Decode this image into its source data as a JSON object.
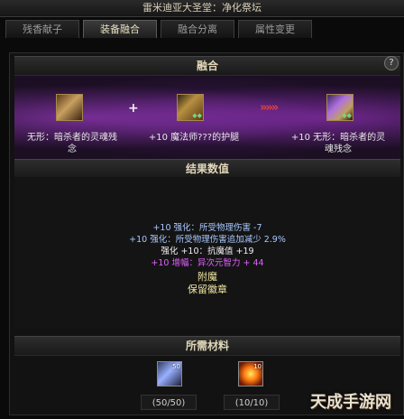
{
  "window": {
    "title": "雷米迪亚大圣堂：净化祭坛"
  },
  "tabs": [
    {
      "label": "残香献子",
      "active": false
    },
    {
      "label": "装备融合",
      "active": true
    },
    {
      "label": "融合分离",
      "active": false
    },
    {
      "label": "属性变更",
      "active": false
    }
  ],
  "fusion": {
    "title": "融合",
    "help_label": "?",
    "items": [
      {
        "icon": "gauntlet-item-icon",
        "label": "无形：暗杀者的灵魂残念"
      },
      {
        "icon": "leg-armor-item-icon",
        "label": "+10 魔法师???的护腿"
      },
      {
        "icon": "fused-leg-armor-item-icon",
        "label": "+10 无形：暗杀者的灵魂残念"
      }
    ],
    "plus_symbol": "+",
    "arrow_symbol": "»»»"
  },
  "result": {
    "title": "结果数值",
    "lines": [
      "+10 强化：所受物理伤害 -7",
      "+10 强化：所受物理伤害追加减少 2.9%",
      "强化 +10：抗魔值 +19",
      "+10 增幅：异次元智力 + 44",
      "附魔",
      "保留徽章"
    ]
  },
  "materials": {
    "title": "所需材料",
    "items": [
      {
        "icon": "crystal-material-icon",
        "count_badge": "50",
        "amount": "(50/50)"
      },
      {
        "icon": "sun-orb-material-icon",
        "count_badge": "10",
        "amount": "(10/10)"
      }
    ]
  },
  "watermark": {
    "text": "天成手游网"
  },
  "colors": {
    "enhance_text": "#a8c8ff",
    "amplify_text": "#e060ff",
    "arrow": "#e04040"
  }
}
